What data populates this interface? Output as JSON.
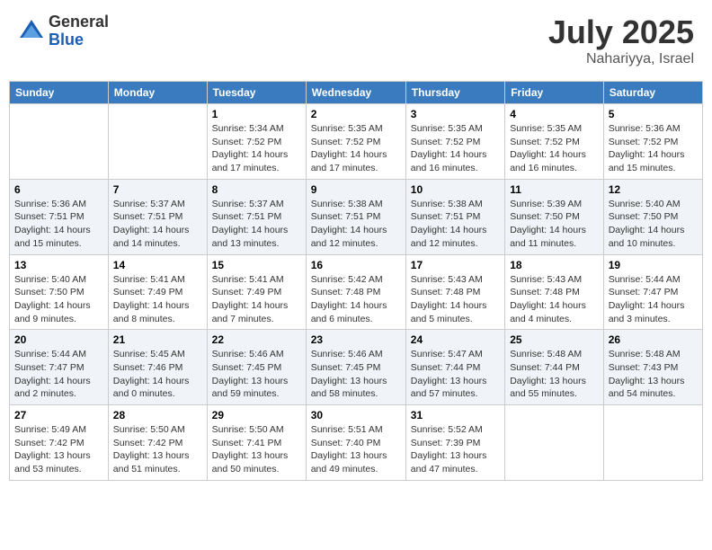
{
  "header": {
    "logo_general": "General",
    "logo_blue": "Blue",
    "month": "July 2025",
    "location": "Nahariyya, Israel"
  },
  "weekdays": [
    "Sunday",
    "Monday",
    "Tuesday",
    "Wednesday",
    "Thursday",
    "Friday",
    "Saturday"
  ],
  "weeks": [
    [
      {
        "day": "",
        "info": ""
      },
      {
        "day": "",
        "info": ""
      },
      {
        "day": "1",
        "info": "Sunrise: 5:34 AM\nSunset: 7:52 PM\nDaylight: 14 hours and 17 minutes."
      },
      {
        "day": "2",
        "info": "Sunrise: 5:35 AM\nSunset: 7:52 PM\nDaylight: 14 hours and 17 minutes."
      },
      {
        "day": "3",
        "info": "Sunrise: 5:35 AM\nSunset: 7:52 PM\nDaylight: 14 hours and 16 minutes."
      },
      {
        "day": "4",
        "info": "Sunrise: 5:35 AM\nSunset: 7:52 PM\nDaylight: 14 hours and 16 minutes."
      },
      {
        "day": "5",
        "info": "Sunrise: 5:36 AM\nSunset: 7:52 PM\nDaylight: 14 hours and 15 minutes."
      }
    ],
    [
      {
        "day": "6",
        "info": "Sunrise: 5:36 AM\nSunset: 7:51 PM\nDaylight: 14 hours and 15 minutes."
      },
      {
        "day": "7",
        "info": "Sunrise: 5:37 AM\nSunset: 7:51 PM\nDaylight: 14 hours and 14 minutes."
      },
      {
        "day": "8",
        "info": "Sunrise: 5:37 AM\nSunset: 7:51 PM\nDaylight: 14 hours and 13 minutes."
      },
      {
        "day": "9",
        "info": "Sunrise: 5:38 AM\nSunset: 7:51 PM\nDaylight: 14 hours and 12 minutes."
      },
      {
        "day": "10",
        "info": "Sunrise: 5:38 AM\nSunset: 7:51 PM\nDaylight: 14 hours and 12 minutes."
      },
      {
        "day": "11",
        "info": "Sunrise: 5:39 AM\nSunset: 7:50 PM\nDaylight: 14 hours and 11 minutes."
      },
      {
        "day": "12",
        "info": "Sunrise: 5:40 AM\nSunset: 7:50 PM\nDaylight: 14 hours and 10 minutes."
      }
    ],
    [
      {
        "day": "13",
        "info": "Sunrise: 5:40 AM\nSunset: 7:50 PM\nDaylight: 14 hours and 9 minutes."
      },
      {
        "day": "14",
        "info": "Sunrise: 5:41 AM\nSunset: 7:49 PM\nDaylight: 14 hours and 8 minutes."
      },
      {
        "day": "15",
        "info": "Sunrise: 5:41 AM\nSunset: 7:49 PM\nDaylight: 14 hours and 7 minutes."
      },
      {
        "day": "16",
        "info": "Sunrise: 5:42 AM\nSunset: 7:48 PM\nDaylight: 14 hours and 6 minutes."
      },
      {
        "day": "17",
        "info": "Sunrise: 5:43 AM\nSunset: 7:48 PM\nDaylight: 14 hours and 5 minutes."
      },
      {
        "day": "18",
        "info": "Sunrise: 5:43 AM\nSunset: 7:48 PM\nDaylight: 14 hours and 4 minutes."
      },
      {
        "day": "19",
        "info": "Sunrise: 5:44 AM\nSunset: 7:47 PM\nDaylight: 14 hours and 3 minutes."
      }
    ],
    [
      {
        "day": "20",
        "info": "Sunrise: 5:44 AM\nSunset: 7:47 PM\nDaylight: 14 hours and 2 minutes."
      },
      {
        "day": "21",
        "info": "Sunrise: 5:45 AM\nSunset: 7:46 PM\nDaylight: 14 hours and 0 minutes."
      },
      {
        "day": "22",
        "info": "Sunrise: 5:46 AM\nSunset: 7:45 PM\nDaylight: 13 hours and 59 minutes."
      },
      {
        "day": "23",
        "info": "Sunrise: 5:46 AM\nSunset: 7:45 PM\nDaylight: 13 hours and 58 minutes."
      },
      {
        "day": "24",
        "info": "Sunrise: 5:47 AM\nSunset: 7:44 PM\nDaylight: 13 hours and 57 minutes."
      },
      {
        "day": "25",
        "info": "Sunrise: 5:48 AM\nSunset: 7:44 PM\nDaylight: 13 hours and 55 minutes."
      },
      {
        "day": "26",
        "info": "Sunrise: 5:48 AM\nSunset: 7:43 PM\nDaylight: 13 hours and 54 minutes."
      }
    ],
    [
      {
        "day": "27",
        "info": "Sunrise: 5:49 AM\nSunset: 7:42 PM\nDaylight: 13 hours and 53 minutes."
      },
      {
        "day": "28",
        "info": "Sunrise: 5:50 AM\nSunset: 7:42 PM\nDaylight: 13 hours and 51 minutes."
      },
      {
        "day": "29",
        "info": "Sunrise: 5:50 AM\nSunset: 7:41 PM\nDaylight: 13 hours and 50 minutes."
      },
      {
        "day": "30",
        "info": "Sunrise: 5:51 AM\nSunset: 7:40 PM\nDaylight: 13 hours and 49 minutes."
      },
      {
        "day": "31",
        "info": "Sunrise: 5:52 AM\nSunset: 7:39 PM\nDaylight: 13 hours and 47 minutes."
      },
      {
        "day": "",
        "info": ""
      },
      {
        "day": "",
        "info": ""
      }
    ]
  ]
}
